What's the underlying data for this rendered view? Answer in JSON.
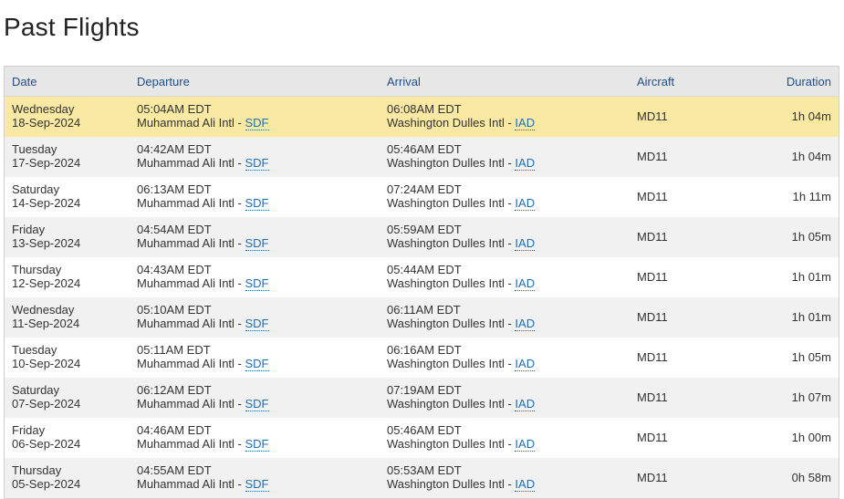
{
  "page": {
    "title": "Past Flights"
  },
  "table": {
    "headers": {
      "date": "Date",
      "departure": "Departure",
      "arrival": "Arrival",
      "aircraft": "Aircraft",
      "duration": "Duration"
    },
    "highlight_color": "#f9e9a2",
    "link_color": "#1f6fb8",
    "rows": [
      {
        "weekday": "Wednesday",
        "date": "18-Sep-2024",
        "dep_time": "05:04AM EDT",
        "dep_airport": "Muhammad Ali Intl - ",
        "dep_code": "SDF",
        "arr_time": "06:08AM EDT",
        "arr_airport": "Washington Dulles Intl - ",
        "arr_code": "IAD",
        "aircraft": "MD11",
        "duration": "1h 04m",
        "highlighted": true
      },
      {
        "weekday": "Tuesday",
        "date": "17-Sep-2024",
        "dep_time": "04:42AM EDT",
        "dep_airport": "Muhammad Ali Intl - ",
        "dep_code": "SDF",
        "arr_time": "05:46AM EDT",
        "arr_airport": "Washington Dulles Intl - ",
        "arr_code": "IAD",
        "aircraft": "MD11",
        "duration": "1h 04m",
        "highlighted": false
      },
      {
        "weekday": "Saturday",
        "date": "14-Sep-2024",
        "dep_time": "06:13AM EDT",
        "dep_airport": "Muhammad Ali Intl - ",
        "dep_code": "SDF",
        "arr_time": "07:24AM EDT",
        "arr_airport": "Washington Dulles Intl - ",
        "arr_code": "IAD",
        "aircraft": "MD11",
        "duration": "1h 11m",
        "highlighted": false
      },
      {
        "weekday": "Friday",
        "date": "13-Sep-2024",
        "dep_time": "04:54AM EDT",
        "dep_airport": "Muhammad Ali Intl - ",
        "dep_code": "SDF",
        "arr_time": "05:59AM EDT",
        "arr_airport": "Washington Dulles Intl - ",
        "arr_code": "IAD",
        "aircraft": "MD11",
        "duration": "1h 05m",
        "highlighted": false
      },
      {
        "weekday": "Thursday",
        "date": "12-Sep-2024",
        "dep_time": "04:43AM EDT",
        "dep_airport": "Muhammad Ali Intl - ",
        "dep_code": "SDF",
        "arr_time": "05:44AM EDT",
        "arr_airport": "Washington Dulles Intl - ",
        "arr_code": "IAD",
        "aircraft": "MD11",
        "duration": "1h 01m",
        "highlighted": false
      },
      {
        "weekday": "Wednesday",
        "date": "11-Sep-2024",
        "dep_time": "05:10AM EDT",
        "dep_airport": "Muhammad Ali Intl - ",
        "dep_code": "SDF",
        "arr_time": "06:11AM EDT",
        "arr_airport": "Washington Dulles Intl - ",
        "arr_code": "IAD",
        "aircraft": "MD11",
        "duration": "1h 01m",
        "highlighted": false
      },
      {
        "weekday": "Tuesday",
        "date": "10-Sep-2024",
        "dep_time": "05:11AM EDT",
        "dep_airport": "Muhammad Ali Intl - ",
        "dep_code": "SDF",
        "arr_time": "06:16AM EDT",
        "arr_airport": "Washington Dulles Intl - ",
        "arr_code": "IAD",
        "aircraft": "MD11",
        "duration": "1h 05m",
        "highlighted": false
      },
      {
        "weekday": "Saturday",
        "date": "07-Sep-2024",
        "dep_time": "06:12AM EDT",
        "dep_airport": "Muhammad Ali Intl - ",
        "dep_code": "SDF",
        "arr_time": "07:19AM EDT",
        "arr_airport": "Washington Dulles Intl - ",
        "arr_code": "IAD",
        "aircraft": "MD11",
        "duration": "1h 07m",
        "highlighted": false
      },
      {
        "weekday": "Friday",
        "date": "06-Sep-2024",
        "dep_time": "04:46AM EDT",
        "dep_airport": "Muhammad Ali Intl - ",
        "dep_code": "SDF",
        "arr_time": "05:46AM EDT",
        "arr_airport": "Washington Dulles Intl - ",
        "arr_code": "IAD",
        "aircraft": "MD11",
        "duration": "1h 00m",
        "highlighted": false
      },
      {
        "weekday": "Thursday",
        "date": "05-Sep-2024",
        "dep_time": "04:55AM EDT",
        "dep_airport": "Muhammad Ali Intl - ",
        "dep_code": "SDF",
        "arr_time": "05:53AM EDT",
        "arr_airport": "Washington Dulles Intl - ",
        "arr_code": "IAD",
        "aircraft": "MD11",
        "duration": "0h 58m",
        "highlighted": false
      }
    ]
  }
}
